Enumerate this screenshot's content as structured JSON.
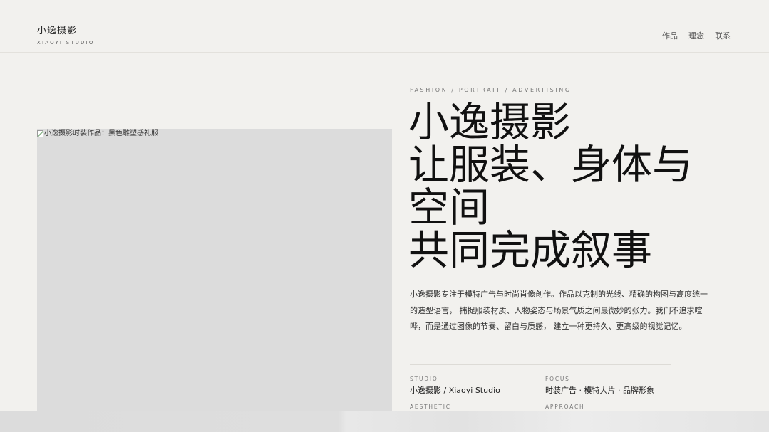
{
  "header": {
    "brand_name": "小逸摄影",
    "brand_sub": "XIAOYI STUDIO",
    "nav": [
      "作品",
      "理念",
      "联系"
    ]
  },
  "photo": {
    "alt": "小逸摄影时装作品：黑色雕塑感礼服"
  },
  "hero": {
    "eyebrow": "FASHION / PORTRAIT / ADVERTISING",
    "title_lines": [
      "小逸摄影",
      "让服装、身体与",
      "空间",
      "共同完成叙事"
    ],
    "intro": "小逸摄影专注于模特广告与时尚肖像创作。作品以克制的光线、精确的构图与高度统一的造型语言， 捕捉服装材质、人物姿态与场景气质之间最微妙的张力。我们不追求喧哗，而是通过图像的节奏、留白与质感， 建立一种更持久、更高级的视觉记忆。"
  },
  "meta": {
    "studio": {
      "label": "STUDIO",
      "value": "小逸摄影 / Xiaoyi Studio"
    },
    "focus": {
      "label": "FOCUS",
      "value": "时装广告 · 模特大片 · 品牌形象"
    },
    "aesthetic": {
      "label": "AESTHETIC",
      "value": ""
    },
    "approach": {
      "label": "APPROACH",
      "value": ""
    }
  }
}
